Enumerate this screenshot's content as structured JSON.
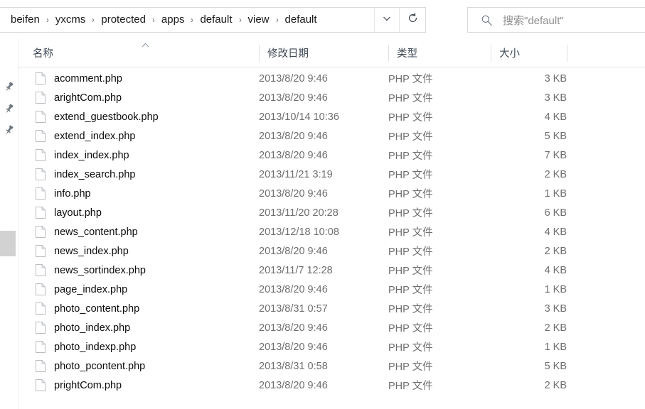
{
  "window": {
    "type": "file-explorer",
    "colors": {
      "accent": "#3f4956",
      "border": "#d9d9d9",
      "text": "#0c0c0c",
      "muted": "#6e6e6e",
      "scroll_thumb": "#d2d2d2"
    }
  },
  "addressbar": {
    "breadcrumbs": [
      "beifen",
      "yxcms",
      "protected",
      "apps",
      "default",
      "view",
      "default"
    ],
    "separator": "›",
    "dropdown_icon": "chevron-down-icon",
    "refresh_icon": "refresh-icon"
  },
  "search": {
    "icon": "search-icon",
    "placeholder": "搜索\"default\""
  },
  "columns": [
    {
      "key": "name",
      "label": "名称",
      "sorted": "asc"
    },
    {
      "key": "date",
      "label": "修改日期",
      "sorted": null
    },
    {
      "key": "type",
      "label": "类型",
      "sorted": null
    },
    {
      "key": "size",
      "label": "大小",
      "sorted": null
    }
  ],
  "sidebar": {
    "pins": [
      {
        "icon": "pin-icon"
      },
      {
        "icon": "pin-icon"
      },
      {
        "icon": "pin-icon"
      }
    ],
    "scroll_thumb": "vertical-scroll-thumb"
  },
  "files": [
    {
      "icon": "php-file-icon",
      "name": "acomment.php",
      "date": "2013/8/20 9:46",
      "type": "PHP 文件",
      "size": "3 KB"
    },
    {
      "icon": "php-file-icon",
      "name": "arightCom.php",
      "date": "2013/8/20 9:46",
      "type": "PHP 文件",
      "size": "3 KB"
    },
    {
      "icon": "php-file-icon",
      "name": "extend_guestbook.php",
      "date": "2013/10/14 10:36",
      "type": "PHP 文件",
      "size": "4 KB"
    },
    {
      "icon": "php-file-icon",
      "name": "extend_index.php",
      "date": "2013/8/20 9:46",
      "type": "PHP 文件",
      "size": "5 KB"
    },
    {
      "icon": "php-file-icon",
      "name": "index_index.php",
      "date": "2013/8/20 9:46",
      "type": "PHP 文件",
      "size": "7 KB"
    },
    {
      "icon": "php-file-icon",
      "name": "index_search.php",
      "date": "2013/11/21 3:19",
      "type": "PHP 文件",
      "size": "2 KB"
    },
    {
      "icon": "php-file-icon",
      "name": "info.php",
      "date": "2013/8/20 9:46",
      "type": "PHP 文件",
      "size": "1 KB"
    },
    {
      "icon": "php-file-icon",
      "name": "layout.php",
      "date": "2013/11/20 20:28",
      "type": "PHP 文件",
      "size": "6 KB"
    },
    {
      "icon": "php-file-icon",
      "name": "news_content.php",
      "date": "2013/12/18 10:08",
      "type": "PHP 文件",
      "size": "4 KB"
    },
    {
      "icon": "php-file-icon",
      "name": "news_index.php",
      "date": "2013/8/20 9:46",
      "type": "PHP 文件",
      "size": "2 KB"
    },
    {
      "icon": "php-file-icon",
      "name": "news_sortindex.php",
      "date": "2013/11/7 12:28",
      "type": "PHP 文件",
      "size": "4 KB"
    },
    {
      "icon": "php-file-icon",
      "name": "page_index.php",
      "date": "2013/8/20 9:46",
      "type": "PHP 文件",
      "size": "1 KB"
    },
    {
      "icon": "php-file-icon",
      "name": "photo_content.php",
      "date": "2013/8/31 0:57",
      "type": "PHP 文件",
      "size": "3 KB"
    },
    {
      "icon": "php-file-icon",
      "name": "photo_index.php",
      "date": "2013/8/20 9:46",
      "type": "PHP 文件",
      "size": "2 KB"
    },
    {
      "icon": "php-file-icon",
      "name": "photo_indexp.php",
      "date": "2013/8/20 9:46",
      "type": "PHP 文件",
      "size": "1 KB"
    },
    {
      "icon": "php-file-icon",
      "name": "photo_pcontent.php",
      "date": "2013/8/31 0:58",
      "type": "PHP 文件",
      "size": "5 KB"
    },
    {
      "icon": "php-file-icon",
      "name": "prightCom.php",
      "date": "2013/8/20 9:46",
      "type": "PHP 文件",
      "size": "2 KB"
    }
  ]
}
